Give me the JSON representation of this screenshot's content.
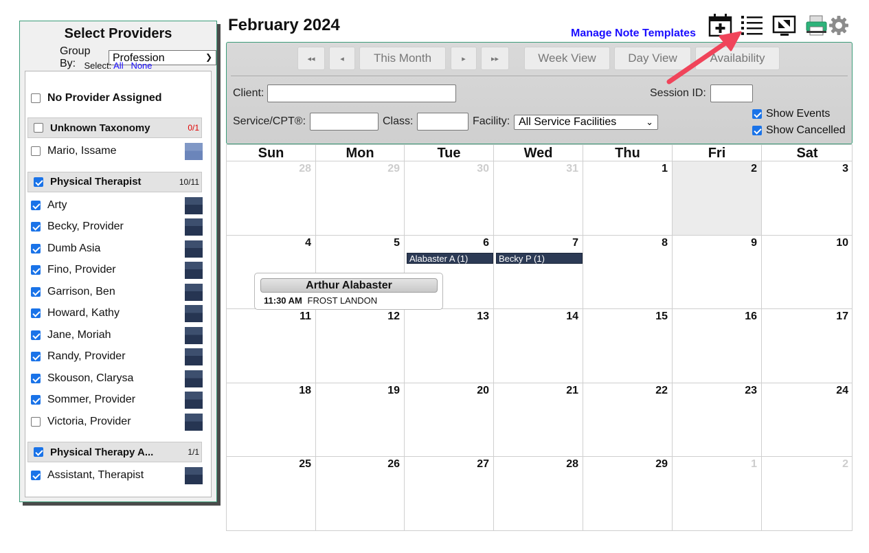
{
  "providers_panel": {
    "title": "Select Providers",
    "group_by_label": "Group By:",
    "group_by_value": "Profession",
    "select_label": "Select:",
    "select_all": "All",
    "select_none": "None",
    "no_provider": {
      "label": "No Provider Assigned",
      "checked": false
    },
    "groups": [
      {
        "name": "Unknown Taxonomy",
        "count": "0/1",
        "checked": false,
        "providers": [
          {
            "name": "Mario, Issame",
            "checked": false
          }
        ]
      },
      {
        "name": "Physical Therapist",
        "count": "10/11",
        "checked": true,
        "providers": [
          {
            "name": "Arty",
            "checked": true
          },
          {
            "name": "Becky, Provider",
            "checked": true
          },
          {
            "name": "Dumb Asia",
            "checked": true
          },
          {
            "name": "Fino, Provider",
            "checked": true
          },
          {
            "name": "Garrison, Ben",
            "checked": true
          },
          {
            "name": "Howard, Kathy",
            "checked": true
          },
          {
            "name": "Jane, Moriah",
            "checked": true
          },
          {
            "name": "Randy, Provider",
            "checked": true
          },
          {
            "name": "Skouson, Clarysa",
            "checked": true
          },
          {
            "name": "Sommer, Provider",
            "checked": true
          },
          {
            "name": "Victoria, Provider",
            "checked": false
          }
        ]
      },
      {
        "name": "Physical Therapy A...",
        "count": "1/1",
        "checked": true,
        "providers": [
          {
            "name": "Assistant, Therapist",
            "checked": true
          }
        ]
      }
    ]
  },
  "header": {
    "month_title": "February 2024",
    "manage_link": "Manage Note Templates",
    "icons": [
      "add-event-calendar-icon",
      "list-view-icon",
      "fullscreen-icon",
      "printer-icon",
      "gear-icon"
    ]
  },
  "toolbar": {
    "first_btn": "◂◂",
    "prev_btn": "◂",
    "this_month": "This Month",
    "next_btn": "▸",
    "last_btn": "▸▸",
    "week_view": "Week View",
    "day_view": "Day View",
    "availability": "Availability",
    "client_label": "Client:",
    "client_value": "",
    "session_label": "Session ID:",
    "session_value": "",
    "service_label": "Service/CPT®:",
    "service_value": "",
    "class_label": "Class:",
    "class_value": "",
    "facility_label": "Facility:",
    "facility_value": "All Service Facilities",
    "show_events": {
      "label": "Show Events",
      "checked": true
    },
    "show_cancelled": {
      "label": "Show Cancelled",
      "checked": true
    }
  },
  "calendar": {
    "days_of_week": [
      "Sun",
      "Mon",
      "Tue",
      "Wed",
      "Thu",
      "Fri",
      "Sat"
    ],
    "weeks": [
      [
        {
          "d": "28",
          "other": true
        },
        {
          "d": "29",
          "other": true
        },
        {
          "d": "30",
          "other": true
        },
        {
          "d": "31",
          "other": true
        },
        {
          "d": "1"
        },
        {
          "d": "2",
          "today": true
        },
        {
          "d": "3"
        }
      ],
      [
        {
          "d": "4"
        },
        {
          "d": "5"
        },
        {
          "d": "6"
        },
        {
          "d": "7"
        },
        {
          "d": "8"
        },
        {
          "d": "9"
        },
        {
          "d": "10"
        }
      ],
      [
        {
          "d": "11"
        },
        {
          "d": "12"
        },
        {
          "d": "13"
        },
        {
          "d": "14"
        },
        {
          "d": "15"
        },
        {
          "d": "16"
        },
        {
          "d": "17"
        }
      ],
      [
        {
          "d": "18"
        },
        {
          "d": "19"
        },
        {
          "d": "20"
        },
        {
          "d": "21"
        },
        {
          "d": "22"
        },
        {
          "d": "23"
        },
        {
          "d": "24"
        }
      ],
      [
        {
          "d": "25"
        },
        {
          "d": "26"
        },
        {
          "d": "27"
        },
        {
          "d": "28"
        },
        {
          "d": "29"
        },
        {
          "d": "1",
          "other": true
        },
        {
          "d": "2",
          "other": true
        }
      ]
    ],
    "events": [
      {
        "label": "Alabaster A (1)",
        "week": 1,
        "day": 2
      },
      {
        "label": "Becky P (1)",
        "week": 1,
        "day": 3
      }
    ]
  },
  "appointment_card": {
    "name": "Arthur Alabaster",
    "time": "11:30 AM",
    "facility": "FROST LANDON"
  },
  "colors": {
    "accent_green": "#3a9b78",
    "link_blue": "#1a0dff",
    "event_navy": "#2c3a55",
    "arrow_red": "#f0445a"
  }
}
